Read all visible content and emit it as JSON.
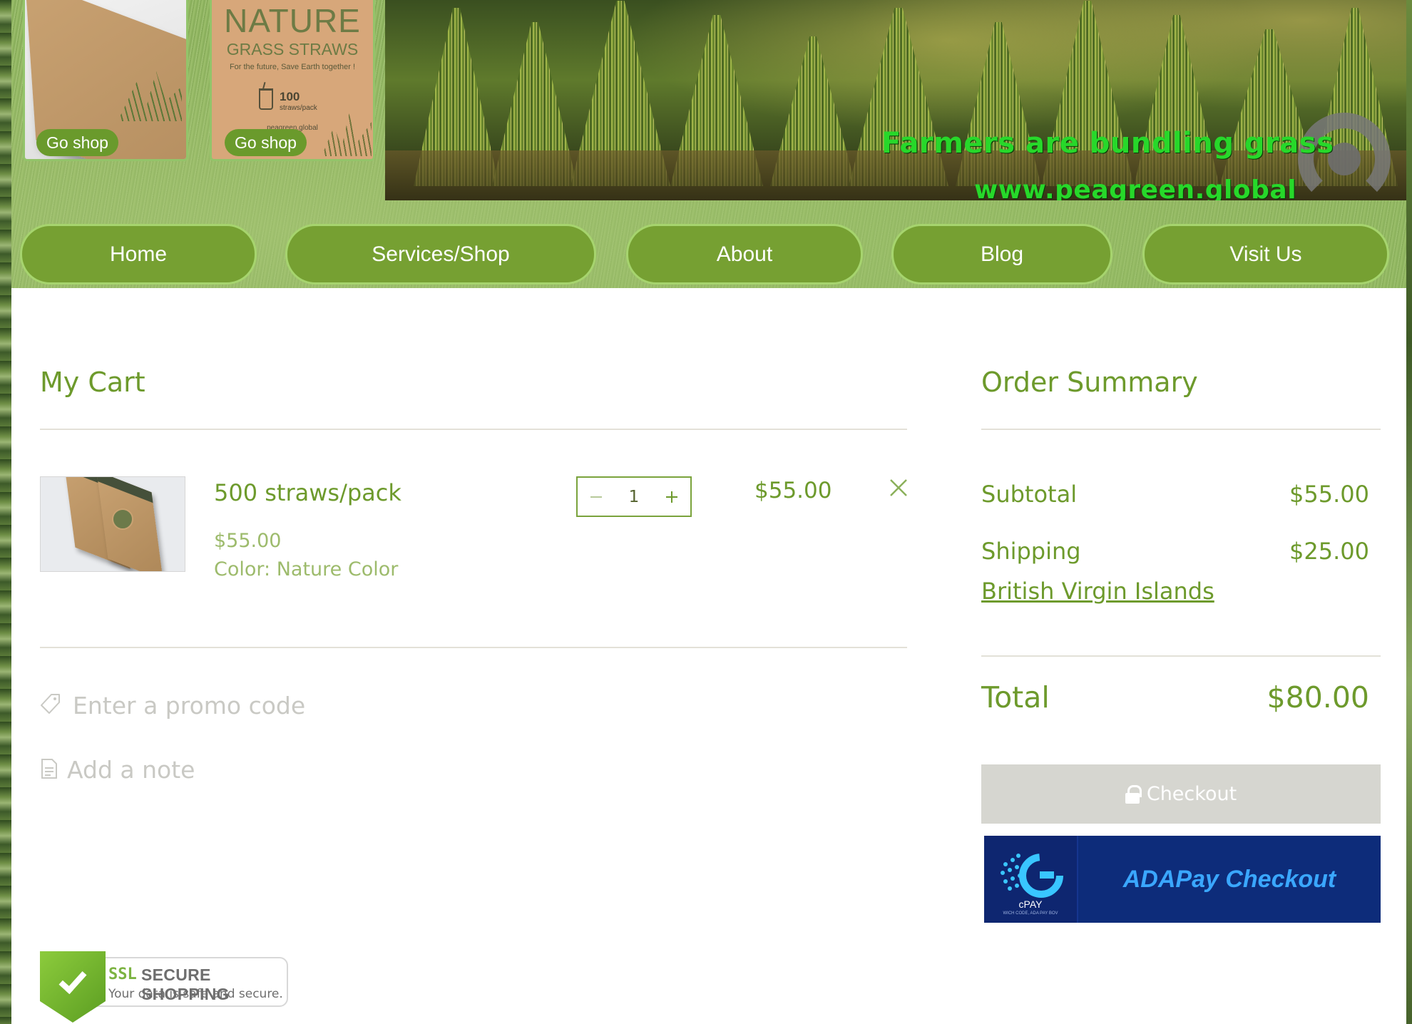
{
  "header": {
    "card1": {
      "go_shop_label": "Go shop"
    },
    "card2": {
      "title": "NATURE",
      "subtitle": "GRASS STRAWS",
      "tagline": "For the future, Save Earth together !",
      "count": "100",
      "count_unit": "straws/pack",
      "brand": "peagreen.global",
      "go_shop_label": "Go shop"
    },
    "photo": {
      "caption": "Farmers are bundling grass",
      "url": "www.peagreen.global"
    }
  },
  "nav": {
    "items": [
      {
        "label": "Home"
      },
      {
        "label": "Services/Shop"
      },
      {
        "label": "About"
      },
      {
        "label": "Blog"
      },
      {
        "label": "Visit Us"
      }
    ]
  },
  "cart": {
    "title": "My Cart",
    "items": [
      {
        "name": "500 straws/pack",
        "unit_price": "$55.00",
        "color": "Color: Nature Color",
        "quantity": "1",
        "line_total": "$55.00"
      }
    ],
    "promo_placeholder": "Enter a promo code",
    "note_placeholder": "Add a note"
  },
  "summary": {
    "title": "Order Summary",
    "subtotal_label": "Subtotal",
    "subtotal_value": "$55.00",
    "shipping_label": "Shipping",
    "shipping_value": "$25.00",
    "shipping_region": "British Virgin Islands",
    "total_label": "Total",
    "total_value": "$80.00",
    "checkout_label": "Checkout",
    "adapay": {
      "logo_text": "cPAY",
      "logo_subtext": "WICH CODE, ADA PAY BOV",
      "label": "ADAPay Checkout"
    }
  },
  "ssl_badge": {
    "tag": "SSL",
    "title": "SECURE SHOPPING",
    "subtitle": "Your data is safe and secure."
  },
  "colors": {
    "accent": "#6d9a2c",
    "nav_bg": "#76a032",
    "nav_border": "#a6d46e",
    "muted": "#c9c9c4",
    "checkout_disabled": "#d6d6d0",
    "adapay_bg": "#0d2c7a",
    "adapay_text": "#3aa7ff"
  }
}
